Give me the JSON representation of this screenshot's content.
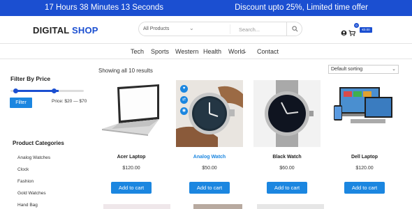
{
  "topbar": {
    "countdown": "17 Hours 38 Minutes 13 Seconds",
    "offer": "Discount upto 25%, Limited time offer",
    "background_color": "#1b4fd1"
  },
  "header": {
    "logo_part1": "DIGITAL ",
    "logo_part2": "SHOP",
    "search": {
      "category": "All Products",
      "placeholder": "Search..."
    },
    "cart": {
      "count": "0",
      "total": "€0.00"
    }
  },
  "nav": {
    "items": [
      "Tech",
      "Sports",
      "Western",
      "Health",
      "World",
      "Contact"
    ]
  },
  "sidebar": {
    "filter_title": "Filter By Price",
    "filter_button": "Filter",
    "price_range": "Price: $20 — $70",
    "price_slider": {
      "min": 20,
      "max": 70
    },
    "categories_title": "Product Categories",
    "categories": [
      "Analog Watches",
      "Clock",
      "Fashion",
      "Gold Watches",
      "Hand Bag"
    ]
  },
  "main": {
    "showing": "Showing all 10 results",
    "sort_selected": "Default sorting",
    "products": [
      {
        "name": "Acer Laptop",
        "price": "$120.00",
        "button": "Add to cart",
        "image_icon": "laptop-image"
      },
      {
        "name": "Analog Watch",
        "price": "$50.00",
        "button": "Add to cart",
        "image_icon": "watch-image"
      },
      {
        "name": "Black Watch",
        "price": "$60.00",
        "button": "Add to cart",
        "image_icon": "watch-image"
      },
      {
        "name": "Dell Laptop",
        "price": "$120.00",
        "button": "Add to cart",
        "image_icon": "devices-image"
      }
    ]
  },
  "colors": {
    "accent": "#1b86e0",
    "brand": "#1b4fd1"
  }
}
